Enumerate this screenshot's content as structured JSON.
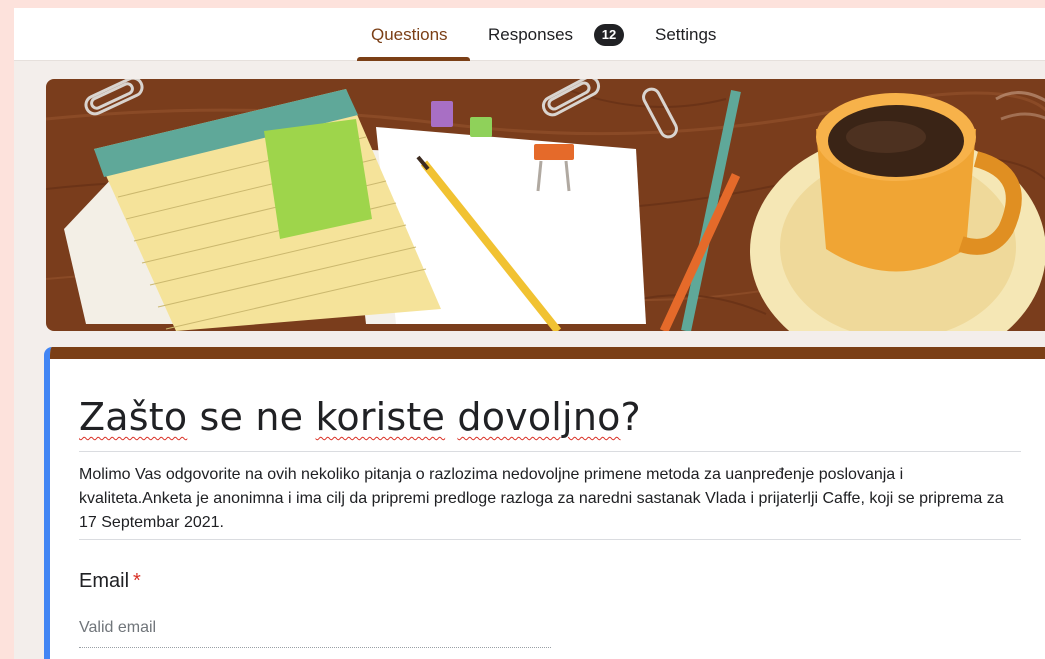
{
  "tabs": {
    "questions": "Questions",
    "responses": "Responses",
    "responses_count": "12",
    "settings": "Settings"
  },
  "form": {
    "title_part1": "Zašto",
    "title_part2": " se ne ",
    "title_part3": "koriste",
    "title_part4": " ",
    "title_part5": "dovoljno",
    "title_part6": "?",
    "description": "Molimo Vas odgovorite na ovih nekoliko pitanja o razlozima nedovoljne primene metoda za uanpređenje poslovanja i kvaliteta.Anketa je anonimna i ima cilj da pripremi predloge razloga za naredni sastanak Vlada i prijaterlji Caffe, koji se priprema za 17 Septembar 2021.",
    "email_label": "Email",
    "required_marker": "*",
    "email_placeholder": "Valid email"
  },
  "theme": {
    "accent": "#7b3f16",
    "left_border": "#4285f4",
    "error_red": "#d93025"
  }
}
